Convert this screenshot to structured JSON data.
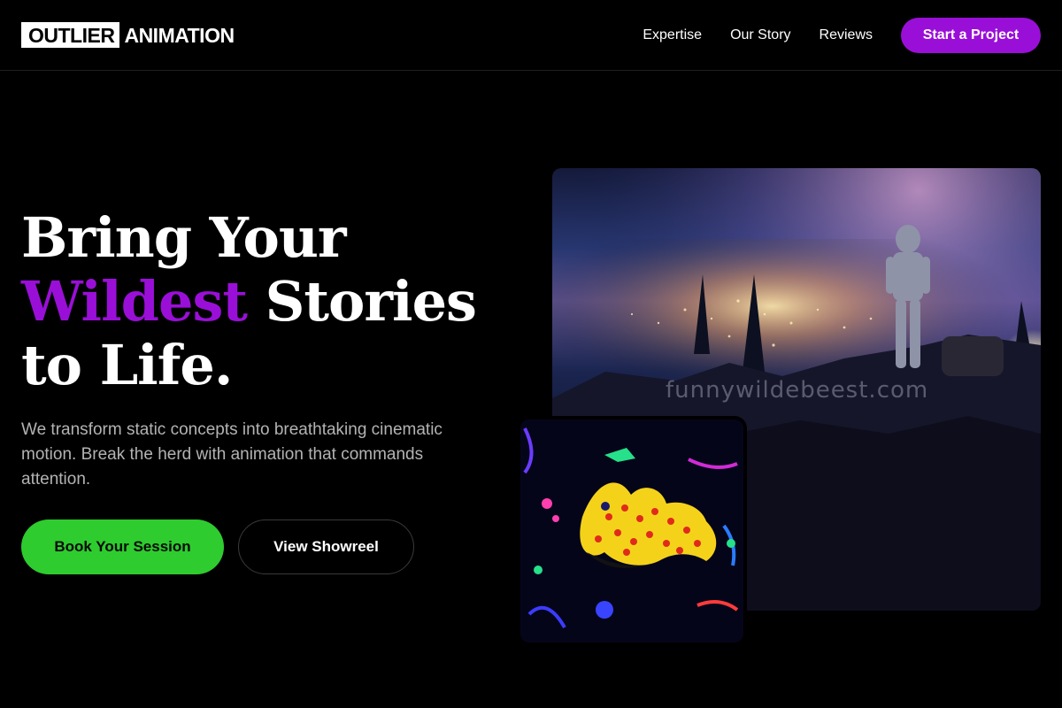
{
  "brand": {
    "logo_box": "OUTLIER",
    "logo_rest": "ANIMATION"
  },
  "nav": {
    "links": [
      "Expertise",
      "Our Story",
      "Reviews"
    ],
    "cta": "Start a Project"
  },
  "hero": {
    "line1": "Bring Your",
    "line2_accent": "Wildest",
    "line2_rest": " Stories",
    "line3": "to Life.",
    "subtext": "We transform static concepts into breathtaking cinematic motion. Break the herd with animation that commands attention.",
    "primary_button": "Book Your Session",
    "secondary_button": "View Showreel"
  },
  "images": {
    "main_watermark": "funnywildebeest.com",
    "main_icon": "astronaut-cliff-image",
    "inset_icon": "neon-creature-image"
  },
  "colors": {
    "accent": "#9a0fd8",
    "primary_button": "#2ecc2e",
    "background": "#000000"
  }
}
